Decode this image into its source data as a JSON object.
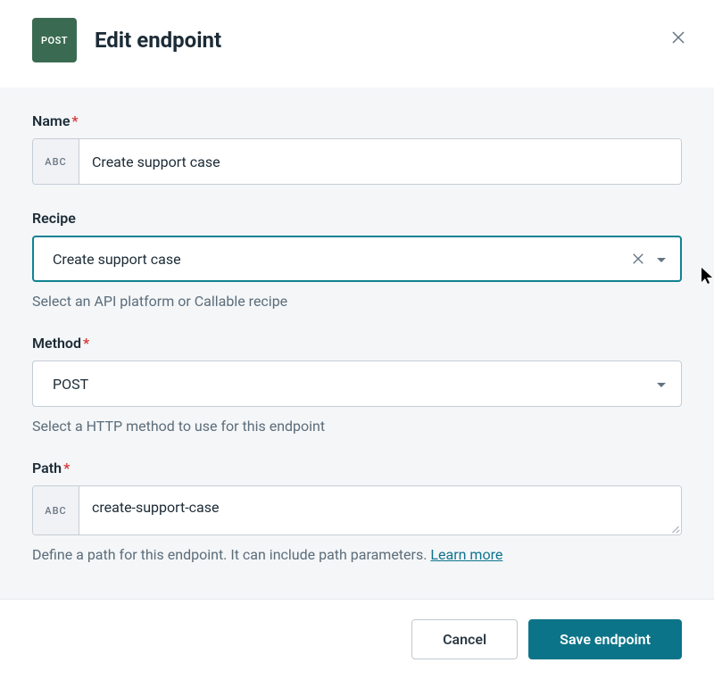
{
  "header": {
    "badge_text": "POST",
    "title": "Edit endpoint"
  },
  "fields": {
    "name": {
      "label": "Name",
      "required": true,
      "prefix": "ABC",
      "value": "Create support case"
    },
    "recipe": {
      "label": "Recipe",
      "required": false,
      "value": "Create support case",
      "help": "Select an API platform or Callable recipe"
    },
    "method": {
      "label": "Method",
      "required": true,
      "value": "POST",
      "help": "Select a HTTP method to use for this endpoint"
    },
    "path": {
      "label": "Path",
      "required": true,
      "prefix": "ABC",
      "value": "create-support-case",
      "help_prefix": "Define a path for this endpoint. It can include path parameters. ",
      "help_link": "Learn more"
    }
  },
  "footer": {
    "cancel": "Cancel",
    "save": "Save endpoint"
  },
  "required_mark": "*"
}
